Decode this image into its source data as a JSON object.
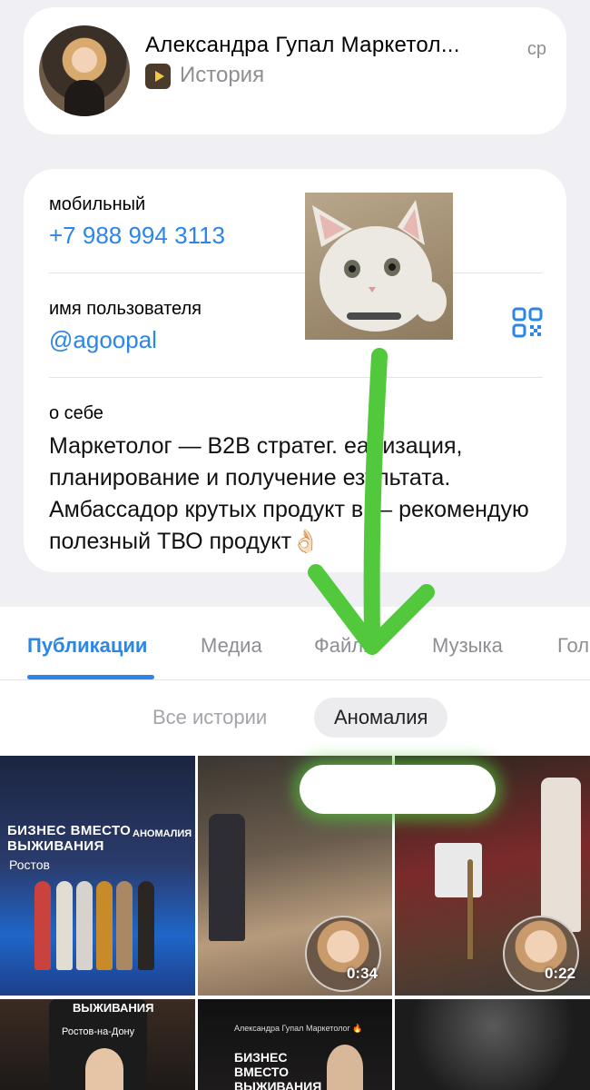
{
  "header": {
    "name": "Александра Гупал Маркетол...",
    "time": "ср",
    "story_label": "История"
  },
  "info": {
    "phone_label": "мобильный",
    "phone_value": "+7 988 994 3113",
    "username_label": "имя пользователя",
    "username_value": "@agoopal",
    "about_label": "о себе",
    "about_text": "Маркетолог — B2B стратег. еализация, планирование и получение езультата. Амбассадор крутых продукт в — рекомендую полезный ТВО  продукт👌🏻"
  },
  "tabs": [
    {
      "label": "Публикации",
      "active": true
    },
    {
      "label": "Медиа",
      "active": false
    },
    {
      "label": "Файлы",
      "active": false
    },
    {
      "label": "Музыка",
      "active": false
    },
    {
      "label": "Гол",
      "active": false
    }
  ],
  "filters": {
    "all_stories": "Все истории",
    "selected": "Аномалия"
  },
  "grid": {
    "tile1_banner": "БИЗНЕС ВМЕСТО ВЫЖИВАНИЯ",
    "tile1_city": "Ростов",
    "tile1_brand": "АНОМАЛИЯ",
    "tile2_duration": "0:34",
    "tile3_duration": "0:22",
    "tile4_banner": "ВЫЖИВАНИЯ",
    "tile4_city": "Ростов-на-Дону",
    "tile5_header": "Александра Гупал Маркетолог 🔥",
    "tile5_banner": "БИЗНЕС ВМЕСТО ВЫЖИВАНИЯ"
  },
  "colors": {
    "accent": "#2b86e8",
    "annotation_arrow": "#52c93c",
    "background": "#efeff4"
  },
  "icons": {
    "qr": "qr-code-icon",
    "story": "story-play-icon"
  }
}
